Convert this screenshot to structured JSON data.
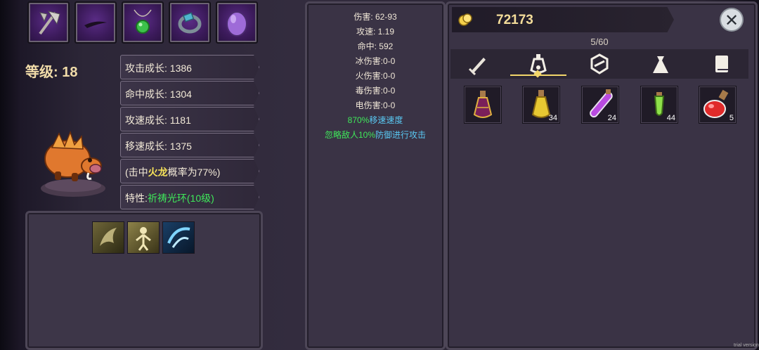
{
  "equipment": [
    {
      "icon": "battle-axe-icon"
    },
    {
      "icon": "dark-blade-icon"
    },
    {
      "icon": "green-amulet-icon"
    },
    {
      "icon": "ring-icon"
    },
    {
      "icon": "purple-egg-icon"
    }
  ],
  "level_text": "等级: 18",
  "stats": [
    "攻击成长: 1386",
    "命中成长: 1304",
    "攻速成长: 1181",
    "移速成长: 1375"
  ],
  "hit_chance": {
    "pre": "(击中",
    "highlight": "火龙",
    "post": "概率为77%)"
  },
  "trait": {
    "pre": "特性:",
    "highlight": "祈祷光环(10级)"
  },
  "pet": {
    "icon": "boar-pet-icon"
  },
  "skills": [
    {
      "icon": "beast-claw-skill-icon"
    },
    {
      "icon": "holy-figure-skill-icon"
    },
    {
      "icon": "blue-strike-skill-icon"
    }
  ],
  "attributes": [
    "伤害: 62-93",
    "攻速: 1.19",
    "命中: 592",
    "冰伤害:0-0",
    "火伤害:0-0",
    "毒伤害:0-0",
    "电伤害:0-0"
  ],
  "bonus_speed": {
    "value": "870%",
    "label": "移速速度"
  },
  "bonus_ignore": {
    "pre": "忽略敌人10%",
    "label": "防御进行攻击"
  },
  "gold": "72173",
  "inventory_count": "5/60",
  "tabs": [
    {
      "icon": "sword-tab-icon"
    },
    {
      "icon": "potion-tab-icon",
      "active": true
    },
    {
      "icon": "gem-tab-icon"
    },
    {
      "icon": "bag-tab-icon"
    },
    {
      "icon": "book-tab-icon"
    }
  ],
  "items": [
    {
      "icon": "purple-flask-icon",
      "qty": ""
    },
    {
      "icon": "yellow-flask-icon",
      "qty": "34"
    },
    {
      "icon": "purple-vial-icon",
      "qty": "24"
    },
    {
      "icon": "green-vial-icon",
      "qty": "44"
    },
    {
      "icon": "red-flask-icon",
      "qty": "5"
    }
  ],
  "watermark": "trial version",
  "colors": {
    "gold_text": "#f4dd9a",
    "highlight_yellow": "#f6e25a",
    "highlight_green": "#3fe85a",
    "highlight_cyan": "#59c8f2"
  }
}
